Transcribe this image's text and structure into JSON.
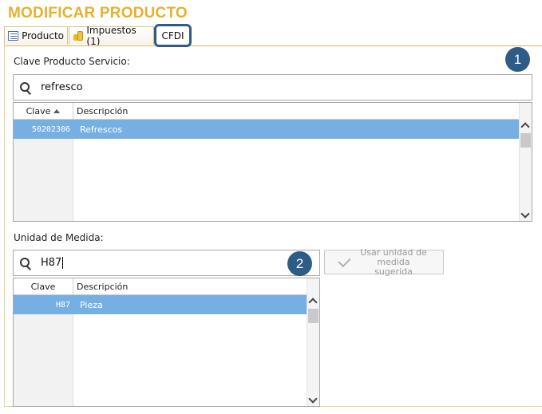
{
  "page": {
    "title": "MODIFICAR PRODUCTO"
  },
  "tabs": [
    {
      "label": "Producto",
      "icon": "form-icon"
    },
    {
      "label": "Impuestos (1)",
      "icon": "coins-icon"
    },
    {
      "label": "CFDI",
      "active": true
    }
  ],
  "clave_section": {
    "label": "Clave Producto Servicio:",
    "badge": "1",
    "search_value": "refresco",
    "columns": {
      "clave": "Clave",
      "descripcion": "Descripción"
    },
    "rows": [
      {
        "clave": "50202306",
        "descripcion": "Refrescos"
      }
    ]
  },
  "unidad_section": {
    "label": "Unidad de Medida:",
    "badge": "2",
    "search_value": "H87",
    "suggest_button": {
      "line1": "Usar unidad de",
      "line2": "medida sugerida",
      "enabled": false
    },
    "columns": {
      "clave": "Clave",
      "descripcion": "Descripción"
    },
    "rows": [
      {
        "clave": "H87",
        "descripcion": "Pieza"
      }
    ]
  },
  "colors": {
    "title": "#e6b12e",
    "badge": "#2f5b87",
    "row_selected": "#76b0e3"
  }
}
